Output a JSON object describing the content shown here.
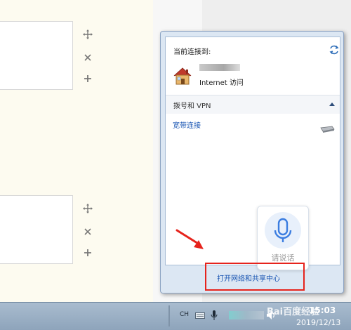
{
  "popup": {
    "current_label": "当前连接到:",
    "network_status": "Internet 访问",
    "section_label": "拨号和 VPN",
    "vpn_item": "宽带连接",
    "footer_link": "打开网络和共享中心"
  },
  "voice": {
    "label": "请说话"
  },
  "taskbar": {
    "lang": "CH",
    "time": "15:03",
    "date": "2019/12/13",
    "watermark": "Bai百度经验"
  },
  "colors": {
    "accent_link": "#1a56b3",
    "highlight": "#e6231c"
  }
}
